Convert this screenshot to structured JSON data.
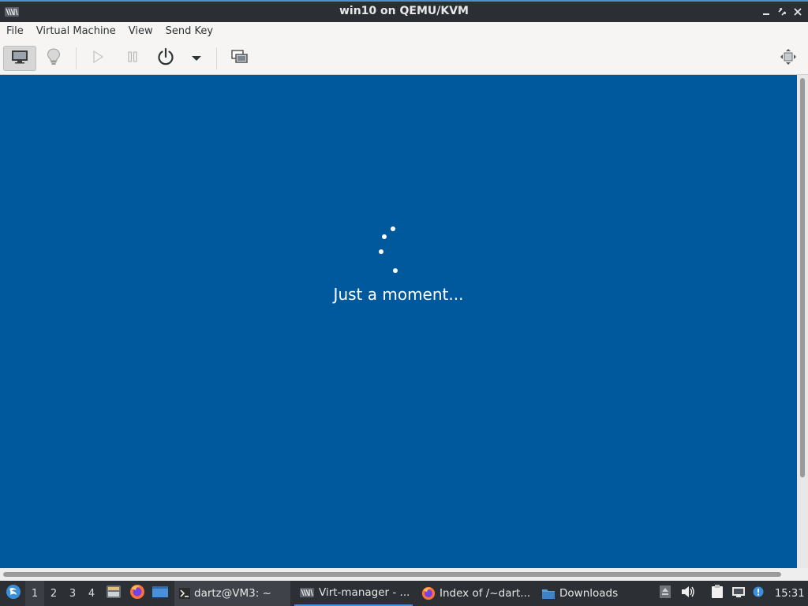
{
  "window": {
    "title": "win10 on QEMU/KVM",
    "app_icon": "virt-manager-icon",
    "controls": [
      "minimize-icon",
      "restore-icon",
      "close-icon"
    ]
  },
  "menubar": {
    "items": [
      {
        "label": "File"
      },
      {
        "label": "Virtual Machine"
      },
      {
        "label": "View"
      },
      {
        "label": "Send Key"
      }
    ]
  },
  "toolbar": {
    "buttons": [
      {
        "icon": "console-display-icon",
        "active": true
      },
      {
        "icon": "details-lightbulb-icon",
        "active": false
      },
      {
        "icon": "run-play-icon",
        "active": false
      },
      {
        "icon": "pause-icon",
        "active": false
      },
      {
        "icon": "power-icon",
        "active": false
      },
      {
        "icon": "power-menu-dropdown-icon",
        "active": false
      },
      {
        "icon": "snapshots-icon",
        "active": false
      },
      {
        "icon": "fullscreen-resize-icon",
        "active": false
      }
    ]
  },
  "guest": {
    "background": "#00599d",
    "message": "Just a moment..."
  },
  "taskbar": {
    "workspaces": [
      "1",
      "2",
      "3",
      "4"
    ],
    "current_workspace": "1",
    "launchers": [
      "file-manager-icon",
      "firefox-icon",
      "show-desktop-icon"
    ],
    "tasks": [
      {
        "label": "dartz@VM3: ~",
        "icon": "terminal-icon"
      },
      {
        "label": "Virt-manager - ...",
        "icon": "virt-manager-icon"
      },
      {
        "label": "Index of /~dart...",
        "icon": "firefox-icon"
      },
      {
        "label": "Downloads",
        "icon": "folder-icon"
      }
    ],
    "tray": [
      "eject-icon",
      "volume-icon",
      "clipboard-icon",
      "network-icon",
      "info-icon"
    ],
    "clock": "15:31"
  }
}
